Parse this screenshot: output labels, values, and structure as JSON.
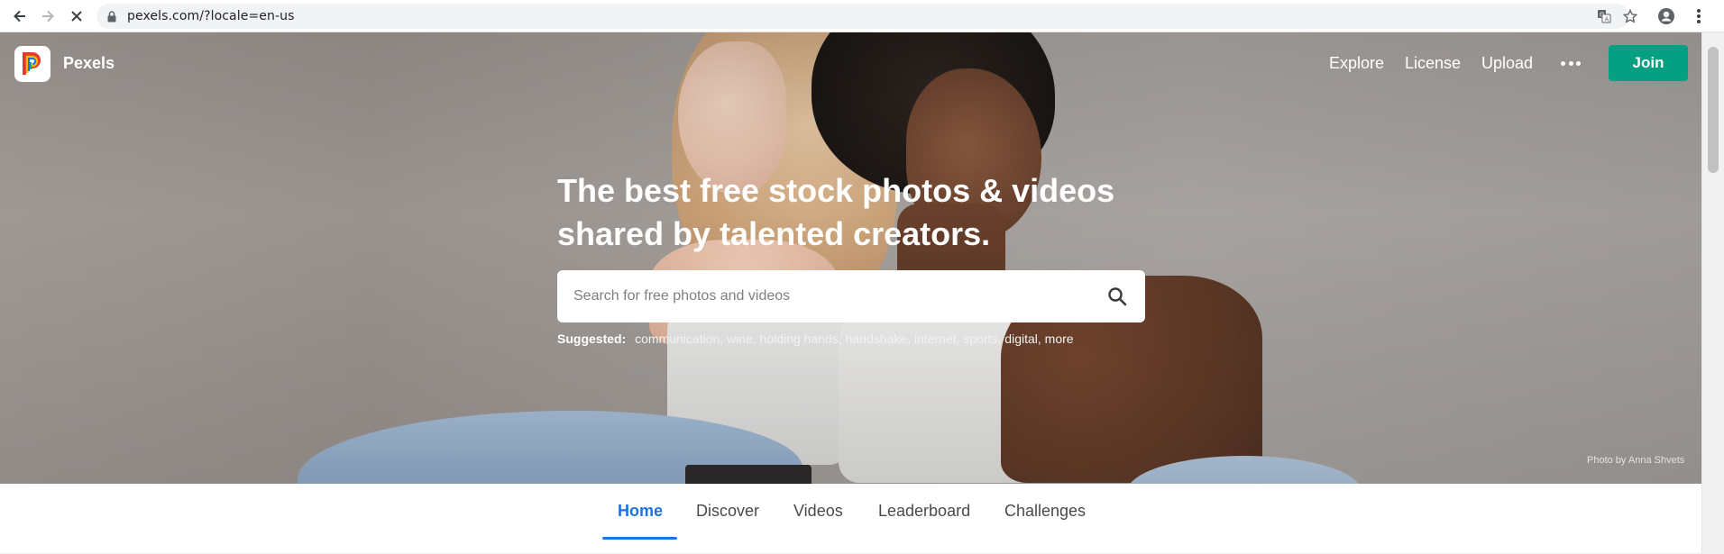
{
  "browser": {
    "url": "pexels.com/?locale=en-us",
    "icons": [
      "back-icon",
      "forward-icon",
      "stop-icon",
      "lock-icon",
      "translate-icon",
      "star-icon",
      "profile-icon",
      "menu-icon"
    ]
  },
  "header": {
    "brand": "Pexels",
    "nav": [
      "Explore",
      "License",
      "Upload"
    ],
    "more_icon": "more-dots-icon",
    "join_label": "Join",
    "join_color": "#05a081"
  },
  "hero": {
    "headline_line1": "The best free stock photos & videos",
    "headline_line2": "shared by talented creators.",
    "search_placeholder": "Search for free photos and videos",
    "suggested_label": "Suggested:",
    "suggestions": [
      "communication,",
      "wine,",
      "holding hands,",
      "handshake,",
      "internet,",
      "sports,",
      "digital,",
      "more"
    ],
    "photo_credit": "Photo by Anna Shvets"
  },
  "tabs": {
    "items": [
      "Home",
      "Discover",
      "Videos",
      "Leaderboard",
      "Challenges"
    ],
    "active": "Home",
    "active_color": "#1a73e8"
  }
}
